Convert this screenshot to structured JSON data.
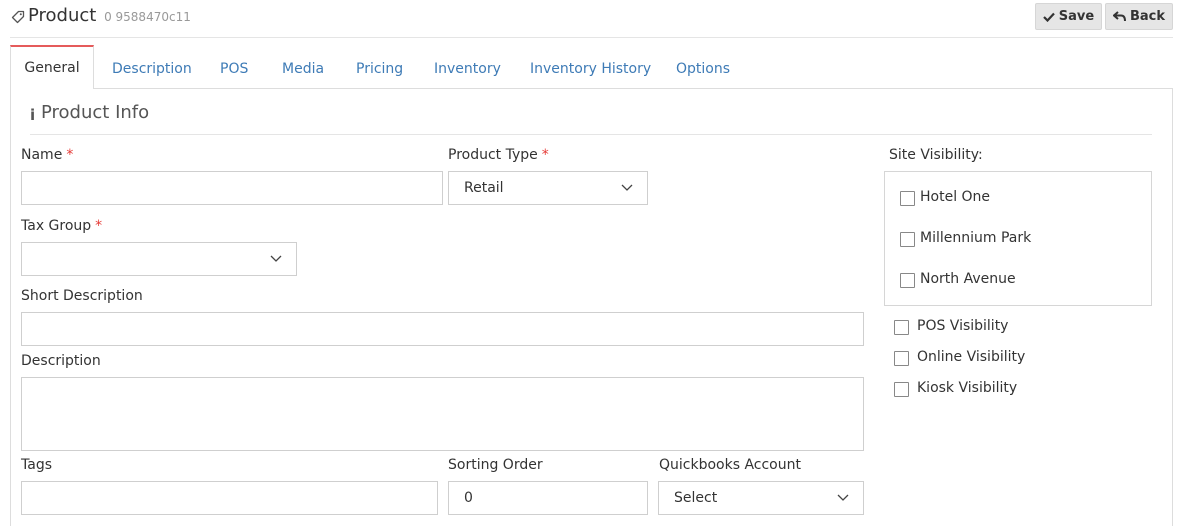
{
  "header": {
    "title": "Product",
    "id_text": "0 9588470c11",
    "save_label": "Save",
    "back_label": "Back"
  },
  "tabs": [
    {
      "label": "General",
      "active": true
    },
    {
      "label": "Description"
    },
    {
      "label": "POS"
    },
    {
      "label": "Media"
    },
    {
      "label": "Pricing"
    },
    {
      "label": "Inventory"
    },
    {
      "label": "Inventory History"
    },
    {
      "label": "Options"
    }
  ],
  "section": {
    "title": "Product Info"
  },
  "form": {
    "name": {
      "label": "Name",
      "required_mark": "*",
      "value": ""
    },
    "product_type": {
      "label": "Product Type",
      "required_mark": "*",
      "value": "Retail"
    },
    "tax_group": {
      "label": "Tax Group",
      "required_mark": "*",
      "value": ""
    },
    "short_description": {
      "label": "Short Description",
      "value": ""
    },
    "description": {
      "label": "Description",
      "value": ""
    },
    "tags": {
      "label": "Tags",
      "value": ""
    },
    "sorting_order": {
      "label": "Sorting Order",
      "value": "0"
    },
    "quickbooks_account": {
      "label": "Quickbooks Account",
      "value": "Select"
    }
  },
  "site_visibility": {
    "label": "Site Visibility:",
    "sites": [
      {
        "label": "Hotel One",
        "checked": false
      },
      {
        "label": "Millennium Park",
        "checked": false
      },
      {
        "label": "North Avenue",
        "checked": false
      }
    ]
  },
  "visibility_options": [
    {
      "label": "POS Visibility",
      "checked": false
    },
    {
      "label": "Online Visibility",
      "checked": false
    },
    {
      "label": "Kiosk Visibility",
      "checked": false
    }
  ],
  "colors": {
    "accent": "#3e7bb6",
    "active_tab_border": "#e55b5b",
    "required": "#e53935"
  }
}
